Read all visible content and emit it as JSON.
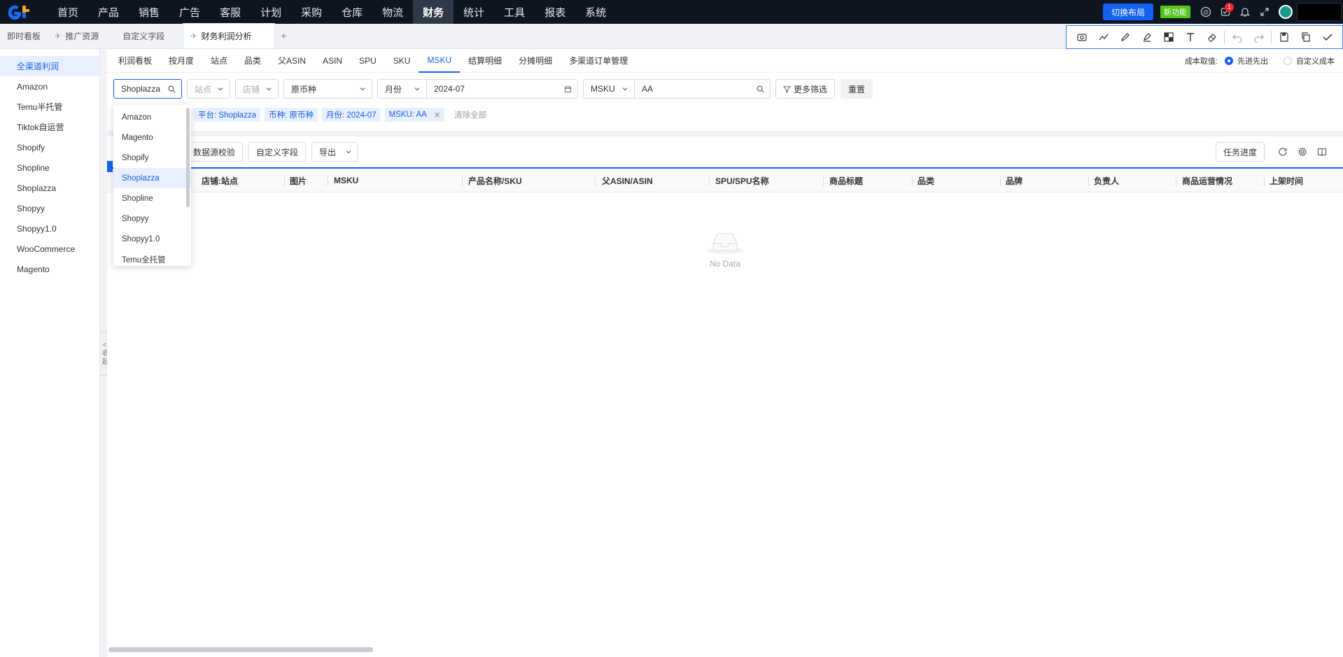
{
  "topbar": {
    "nav": [
      "首页",
      "产品",
      "销售",
      "广告",
      "客服",
      "计划",
      "采购",
      "仓库",
      "物流",
      "财务",
      "统计",
      "工具",
      "报表",
      "系统"
    ],
    "active_nav": "财务",
    "switch_layout": "切换布局",
    "new_feature": "新功能",
    "notification_count": "1"
  },
  "tabs": {
    "items": [
      "即时看板",
      "推广资源",
      "自定义字段"
    ],
    "pinned": "推广资源",
    "active": "财务利润分析",
    "add": "+"
  },
  "sidebar": {
    "items": [
      "全渠道利润",
      "Amazon",
      "Temu半托管",
      "Tiktok自运营",
      "Shopify",
      "Shopline",
      "Shoplazza",
      "Shopyy",
      "Shopyy1.0",
      "WooCommerce",
      "Magento"
    ],
    "active": "全渠道利润",
    "collapse_label": [
      "<|",
      "收",
      "起"
    ]
  },
  "subtabs": {
    "items": [
      "利润看板",
      "按月度",
      "站点",
      "品类",
      "父ASIN",
      "ASIN",
      "SPU",
      "SKU",
      "MSKU",
      "结算明细",
      "分摊明细",
      "多渠道订单管理"
    ],
    "active": "MSKU"
  },
  "cost": {
    "label": "成本取值:",
    "option1": "先进先出",
    "option2": "自定义成本"
  },
  "filters": {
    "platform": "Shoplazza",
    "site_placeholder": "站点",
    "shop_placeholder": "店铺",
    "currency": "原币种",
    "period_type": "月份",
    "period_value": "2024-07",
    "search_type": "MSKU",
    "search_value": "AA",
    "more_filters": "更多筛选",
    "reset": "重置"
  },
  "chips": {
    "items": [
      "平台: Shoplazza",
      "币种: 原币种",
      "月份: 2024-07",
      "MSKU: AA"
    ],
    "clear_all": "清除全部"
  },
  "toolbar": {
    "validate": "数据源校验",
    "custom_fields": "自定义字段",
    "export": "导出",
    "task_progress": "任务进度"
  },
  "table": {
    "columns": [
      "店铺:站点",
      "图片",
      "MSKU",
      "产品名称/SKU",
      "父ASIN/ASIN",
      "SPU/SPU名称",
      "商品标题",
      "品类",
      "品牌",
      "负责人",
      "商品运营情况",
      "上架时间"
    ],
    "empty_text": "No Data"
  },
  "dropdown": {
    "options": [
      "Amazon",
      "Magento",
      "Shopify",
      "Shoplazza",
      "Shopline",
      "Shopyy",
      "Shopyy1.0",
      "Temu全托管"
    ],
    "selected": "Shoplazza"
  }
}
